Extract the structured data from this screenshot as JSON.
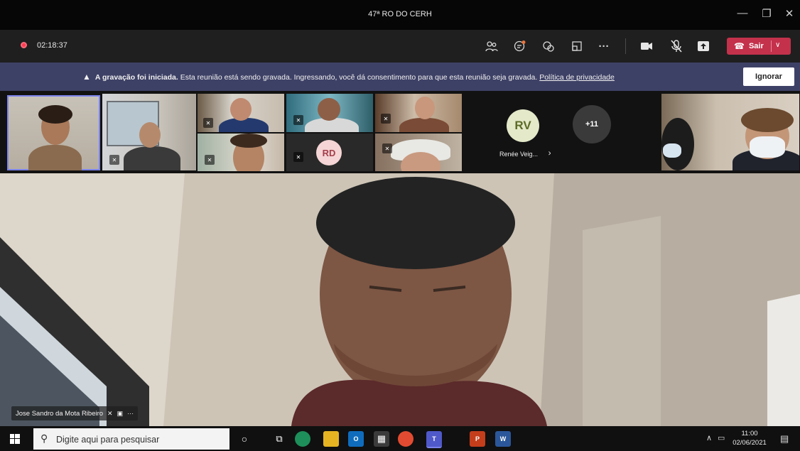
{
  "window": {
    "title": "47ª RO DO CERH",
    "controls": {
      "minimize": "—",
      "restore": "❐",
      "close": "✕"
    }
  },
  "controlbar": {
    "record_time": "02:18:37",
    "leave_label": "Sair",
    "icons": [
      "people-icon",
      "chat-icon",
      "reactions-icon",
      "breakout-icon",
      "more-icon",
      "camera-icon",
      "mic-off-icon",
      "share-icon"
    ]
  },
  "banner": {
    "bold": "A gravação foi iniciada.",
    "text": " Esta reunião está sendo gravada. Ingressando, você dá consentimento para que esta reunião seja gravada. ",
    "link": "Política de privacidade",
    "button": "Ignorar"
  },
  "gallery": {
    "rd_initials": "RD",
    "rv_initials": "RV",
    "rv_name": "Renée Veig...",
    "overflow": "+11"
  },
  "main": {
    "speaker_name": "Jose Sandro da Mota Ribeiro",
    "chip_more": "···"
  },
  "taskbar": {
    "search_placeholder": "Digite aqui para pesquisar",
    "time": "11:00",
    "date": "02/06/2021"
  },
  "colors": {
    "accent": "#7b83eb",
    "leave": "#c4314b",
    "banner": "#3e4166",
    "rd_avatar": "#f5d5d6",
    "rv_avatar": "#e3e9c9"
  }
}
